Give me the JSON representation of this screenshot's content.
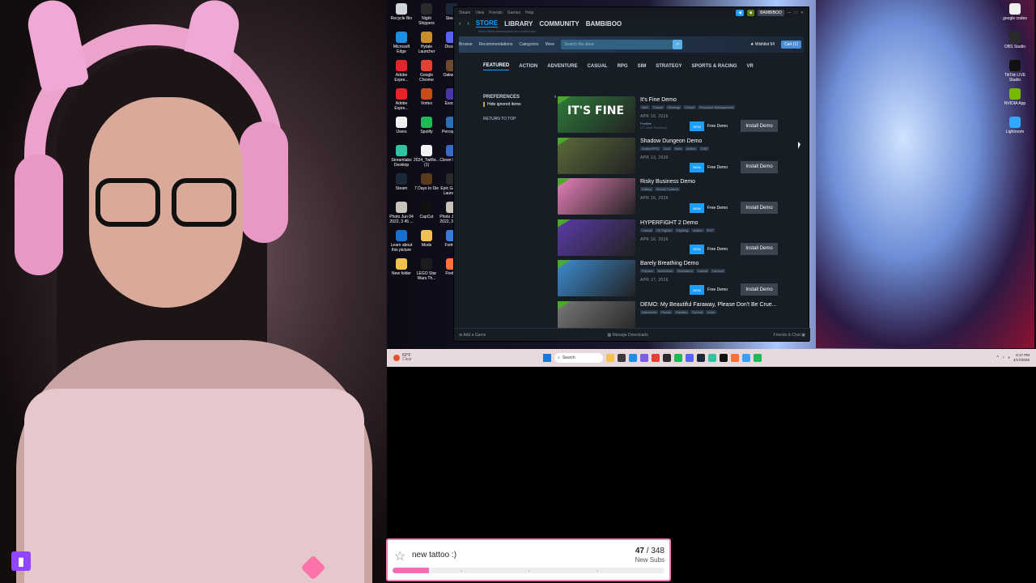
{
  "desktop_icons": [
    {
      "label": "Recycle Bin",
      "color": "#d0d4dc"
    },
    {
      "label": "Night Shippers",
      "color": "#2a2a2a"
    },
    {
      "label": "Steam",
      "color": "#1b2838"
    },
    {
      "label": "Microsoft Edge",
      "color": "#1d8fe3"
    },
    {
      "label": "Hytale Launcher",
      "color": "#c98d2a"
    },
    {
      "label": "Discord",
      "color": "#5865f2"
    },
    {
      "label": "Adobe Expre...",
      "color": "#e3242b"
    },
    {
      "label": "Google Chrome",
      "color": "#e34133"
    },
    {
      "label": "Oakwood",
      "color": "#6b4a2e"
    },
    {
      "label": "Adobe Expre...",
      "color": "#e3242b"
    },
    {
      "label": "Vortex",
      "color": "#cc4a1a"
    },
    {
      "label": "Exodus",
      "color": "#4b36a8"
    },
    {
      "label": "Users",
      "color": "#f0f0f0"
    },
    {
      "label": "Spotify",
      "color": "#1db954"
    },
    {
      "label": "Perception",
      "color": "#2d6fb5"
    },
    {
      "label": "Streamlabs Desktop",
      "color": "#31c3a2"
    },
    {
      "label": "2024_TwiRe... (1)",
      "color": "#f3f3f3"
    },
    {
      "label": "Clever Demo",
      "color": "#3a6ac8"
    },
    {
      "label": "Steam",
      "color": "#1b2838"
    },
    {
      "label": "7 Days to Die",
      "color": "#5a3a1a"
    },
    {
      "label": "Epic Games Launcher",
      "color": "#2a2a2a"
    },
    {
      "label": "Photo Jun 04 2022, 3 45 ...",
      "color": "#c9c2b8"
    },
    {
      "label": "CapCut",
      "color": "#111111"
    },
    {
      "label": "Photo Jun 04 2022, 3 45 ...",
      "color": "#c9c2b8"
    },
    {
      "label": "Learn about this picture",
      "color": "#1a6fd0"
    },
    {
      "label": "Mods",
      "color": "#f2c14e"
    },
    {
      "label": "Fortnite",
      "color": "#3a7ad8"
    },
    {
      "label": "New folder",
      "color": "#f2c14e"
    },
    {
      "label": "LEGO Star Wars Th...",
      "color": "#1c1c1c"
    },
    {
      "label": "Firefox",
      "color": "#ff7139"
    }
  ],
  "right_icons": [
    {
      "label": "google codes",
      "color": "#f0f0f0"
    },
    {
      "label": "OBS Studio",
      "color": "#2a2a2a"
    },
    {
      "label": "TikTok LIVE Studio",
      "color": "#111111"
    },
    {
      "label": "NVIDIA App",
      "color": "#76b900"
    },
    {
      "label": "Lightroom",
      "color": "#31a8ff"
    }
  ],
  "steam": {
    "title_menu": [
      "Steam",
      "View",
      "Friends",
      "Games",
      "Help"
    ],
    "username": "BAMBIBOO",
    "nav": [
      "STORE",
      "LIBRARY",
      "COMMUNITY",
      "BAMBIBOO"
    ],
    "url": "https://store.steampowered.com/demos/",
    "store_menu": [
      "Browse",
      "Recommendations",
      "Categories",
      "More"
    ],
    "search_placeholder": "Search the store",
    "wishlist": "Wishlist",
    "wishlist_count": "54",
    "cart": "Cart",
    "cart_count": "1",
    "genres": [
      "FEATURED",
      "ACTION",
      "ADVENTURE",
      "CASUAL",
      "RPG",
      "SIM",
      "STRATEGY",
      "SPORTS & RACING",
      "VR"
    ],
    "sidebar": {
      "preferences": "PREFERENCES",
      "hide_ignored": "Hide ignored items",
      "return_to_top": "RETURN TO TOP"
    },
    "games": [
      {
        "title": "It's Fine Demo",
        "tags": [
          "Idler",
          "Casual",
          "Strategy",
          "Clicker",
          "Resource Management"
        ],
        "date": "APR 16, 2026",
        "review": "Positive",
        "review_sub": "(17 User Reviews)",
        "thumb_text": "IT'S FINE",
        "thumb_color": "#2e7a3a"
      },
      {
        "title": "Shadow Dungeon Demo",
        "tags": [
          "Action RPG",
          "Loot",
          "Hero",
          "Action",
          "2.5D"
        ],
        "date": "APR 13, 2026",
        "review": "",
        "review_sub": "",
        "thumb_text": "",
        "thumb_color": "#5a6a3a"
      },
      {
        "title": "Risky Business Demo",
        "tags": [
          "Dating",
          "Sexual Content"
        ],
        "date": "APR 16, 2026",
        "review": "",
        "review_sub": "",
        "thumb_text": "",
        "thumb_color": "#e67fb7"
      },
      {
        "title": "HYPERFIGHT 2 Demo",
        "tags": [
          "Casual",
          "2D Fighter",
          "Fighting",
          "Action",
          "PvP"
        ],
        "date": "APR 16, 2026",
        "review": "",
        "review_sub": "",
        "thumb_text": "",
        "thumb_color": "#5a3aa8"
      },
      {
        "title": "Barely Breathing Demo",
        "tags": [
          "Physics",
          "Adventure",
          "Simulation",
          "Casual",
          "Cartoon"
        ],
        "date": "APR 17, 2026",
        "review": "",
        "review_sub": "",
        "thumb_text": "",
        "thumb_color": "#3c8bd0"
      },
      {
        "title": "DEMO: My Beautiful Faraway, Please Don't Be Crue...",
        "tags": [
          "Adventure",
          "Puzzle",
          "Mystery",
          "Surreal",
          "Indie"
        ],
        "date": "",
        "review": "",
        "review_sub": "",
        "thumb_text": "",
        "thumb_color": "#777777"
      }
    ],
    "new_label": "NEW",
    "free_demo_label": "Free Demo",
    "install_label": "Install Demo",
    "status": {
      "add_game": "Add a Game",
      "manage_downloads": "Manage Downloads",
      "friends_chat": "Friends & Chat"
    }
  },
  "taskbar": {
    "weather_temp": "63°F",
    "weather_desc": "Clear",
    "search_label": "Search",
    "time": "6:17 PM",
    "date": "4/17/2026"
  },
  "sub_goal": {
    "title": "new tattoo :)",
    "current": "47",
    "target": "348",
    "separator": "/",
    "label": "New Subs",
    "progress_fraction": 0.135
  },
  "colors": {
    "steam_accent": "#1a9fff",
    "goal_pink": "#f06fb0",
    "twitch_purple": "#9146ff"
  }
}
